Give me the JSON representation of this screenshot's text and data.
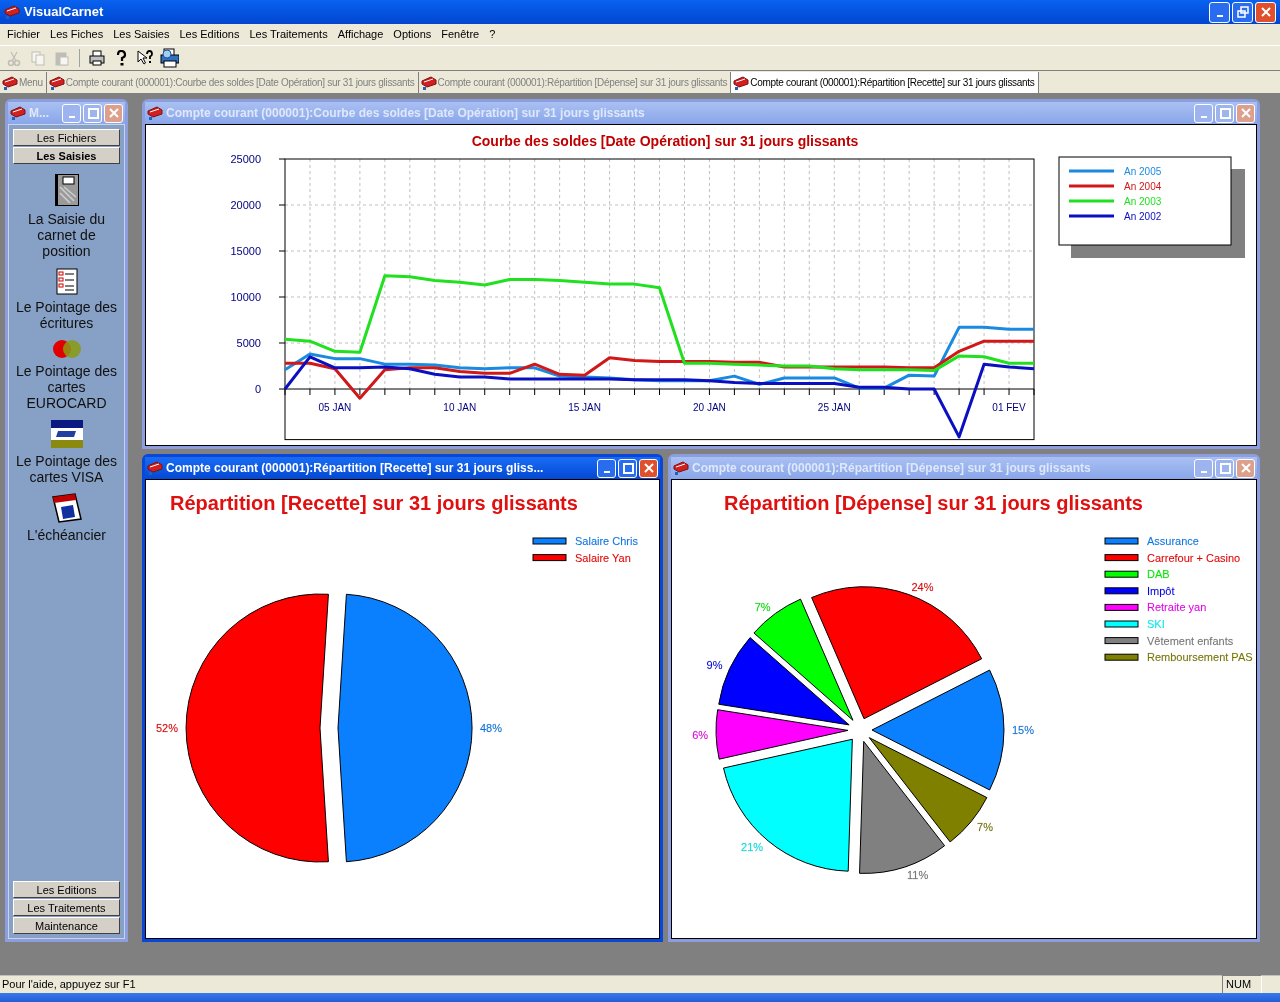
{
  "app": {
    "title": "VisualCarnet"
  },
  "menu_bar": [
    "Fichier",
    "Les Fiches",
    "Les Saisies",
    "Les Editions",
    "Les Traitements",
    "Affichage",
    "Options",
    "Fenêtre",
    "?"
  ],
  "toolbar": [
    {
      "kind": "cut",
      "disabled": true
    },
    {
      "kind": "copy",
      "disabled": true
    },
    {
      "kind": "paste",
      "disabled": true
    },
    {
      "kind": "print",
      "disabled": false
    },
    {
      "kind": "help",
      "disabled": false
    },
    {
      "kind": "context_help",
      "disabled": false
    },
    {
      "kind": "preview",
      "disabled": false
    }
  ],
  "tabs": [
    {
      "label": "Menu",
      "selected": false
    },
    {
      "label": "Compte courant (000001):Courbe des soldes [Date Opération] sur 31 jours glissants",
      "selected": false
    },
    {
      "label": "Compte courant (000001):Répartition [Dépense] sur 31 jours glissants",
      "selected": false
    },
    {
      "label": "Compte courant (000001):Répartition [Recette] sur 31 jours glissants",
      "selected": true
    }
  ],
  "menu_window": {
    "title": "M...",
    "active": false,
    "top_buttons": [
      {
        "label": "Les Fichiers",
        "selected": false
      },
      {
        "label": "Les Saisies",
        "selected": true
      }
    ],
    "items": [
      {
        "kind": "notebook",
        "label": "La Saisie du carnet de position"
      },
      {
        "kind": "checklist",
        "label": "Le Pointage des écritures"
      },
      {
        "kind": "eurocard",
        "label": "Le Pointage des cartes EUROCARD"
      },
      {
        "kind": "visa",
        "label": "Le Pointage des cartes VISA"
      },
      {
        "kind": "calendar",
        "label": "L'échéancier"
      }
    ],
    "bottom_buttons": [
      "Les Editions",
      "Les Traitements",
      "Maintenance"
    ]
  },
  "balance_window": {
    "title": "Compte courant (000001):Courbe des soldes [Date Opération] sur 31 jours glissants",
    "active": false,
    "chart_data": {
      "type": "line",
      "title": "Courbe des soldes [Date Opération] sur 31 jours glissants",
      "legend": "right",
      "categories": [
        null,
        null,
        "05 JAN",
        null,
        null,
        null,
        null,
        "10 JAN",
        null,
        null,
        null,
        null,
        "15 JAN",
        null,
        null,
        null,
        null,
        "20 JAN",
        null,
        null,
        null,
        null,
        "25 JAN",
        null,
        null,
        null,
        null,
        null,
        null,
        "01 FEV",
        null
      ],
      "grid": true,
      "ylim": [
        -5500,
        25000
      ],
      "yticks": [
        0,
        5000,
        10000,
        15000,
        20000,
        25000
      ],
      "series": [
        {
          "name": "An 2005",
          "color": "#1a8ae0",
          "values": [
            2100,
            3800,
            3300,
            3300,
            2700,
            2700,
            2600,
            2300,
            2200,
            2300,
            2300,
            1400,
            1300,
            1200,
            1000,
            900,
            900,
            900,
            1400,
            500,
            1200,
            1200,
            1200,
            100,
            100,
            1500,
            1400,
            6700,
            6700,
            6500,
            6500
          ]
        },
        {
          "name": "An 2004",
          "color": "#d01818",
          "values": [
            2800,
            2800,
            2200,
            -1000,
            2100,
            2300,
            2300,
            1900,
            1700,
            1700,
            2700,
            1600,
            1500,
            3400,
            3100,
            3000,
            3000,
            3000,
            2900,
            2900,
            2400,
            2400,
            2400,
            2400,
            2400,
            2300,
            2300,
            4100,
            5200,
            5200,
            5200
          ]
        },
        {
          "name": "An 2003",
          "color": "#20e020",
          "values": [
            5400,
            5200,
            4100,
            4000,
            12300,
            12200,
            11800,
            11600,
            11300,
            11900,
            11900,
            11800,
            11600,
            11400,
            11400,
            11000,
            2800,
            2800,
            2700,
            2600,
            2500,
            2500,
            2200,
            2100,
            2100,
            2100,
            2000,
            3600,
            3500,
            2800,
            2800
          ]
        },
        {
          "name": "An 2002",
          "color": "#0a10c0",
          "values": [
            0,
            3500,
            2300,
            2300,
            2400,
            2200,
            1600,
            1300,
            1300,
            1100,
            1100,
            1100,
            1100,
            1100,
            1000,
            1000,
            1000,
            900,
            700,
            600,
            600,
            600,
            600,
            200,
            200,
            0,
            0,
            -5200,
            2700,
            2400,
            2200
          ]
        }
      ]
    }
  },
  "income_window": {
    "title": "Compte courant (000001):Répartition [Recette] sur 31 jours gliss...",
    "active": true,
    "chart_data": {
      "type": "pie",
      "title": "Répartition [Recette] sur 31 jours glissants",
      "legend": "right",
      "categories": [
        "Salaire Chris",
        "Salaire Yan"
      ],
      "values": [
        48,
        52
      ],
      "colors": [
        "#0a80ff",
        "#ff0000"
      ],
      "value_labels": [
        "48%",
        "52%"
      ]
    }
  },
  "expense_window": {
    "title": "Compte courant (000001):Répartition [Dépense] sur 31 jours glissants",
    "active": false,
    "chart_data": {
      "type": "pie",
      "title": "Répartition [Dépense] sur 31 jours glissants",
      "legend": "right",
      "categories": [
        "Assurance",
        "Carrefour + Casino",
        "DAB",
        "Impôt",
        "Retraite yan",
        "SKI",
        "Vêtement enfants",
        "Remboursement PAS"
      ],
      "values": [
        15,
        24,
        7,
        9,
        6,
        21,
        11,
        7
      ],
      "colors": [
        "#0a80ff",
        "#ff0000",
        "#00ff00",
        "#0000ff",
        "#ff00ff",
        "#00ffff",
        "#808080",
        "#808000"
      ],
      "value_labels": [
        "15%",
        "24%",
        "7%",
        "9%",
        "6%",
        "21%",
        "11%",
        "7%"
      ]
    }
  },
  "status_bar": {
    "message": "Pour l'aide, appuyez sur F1",
    "indicator": "NUM"
  }
}
